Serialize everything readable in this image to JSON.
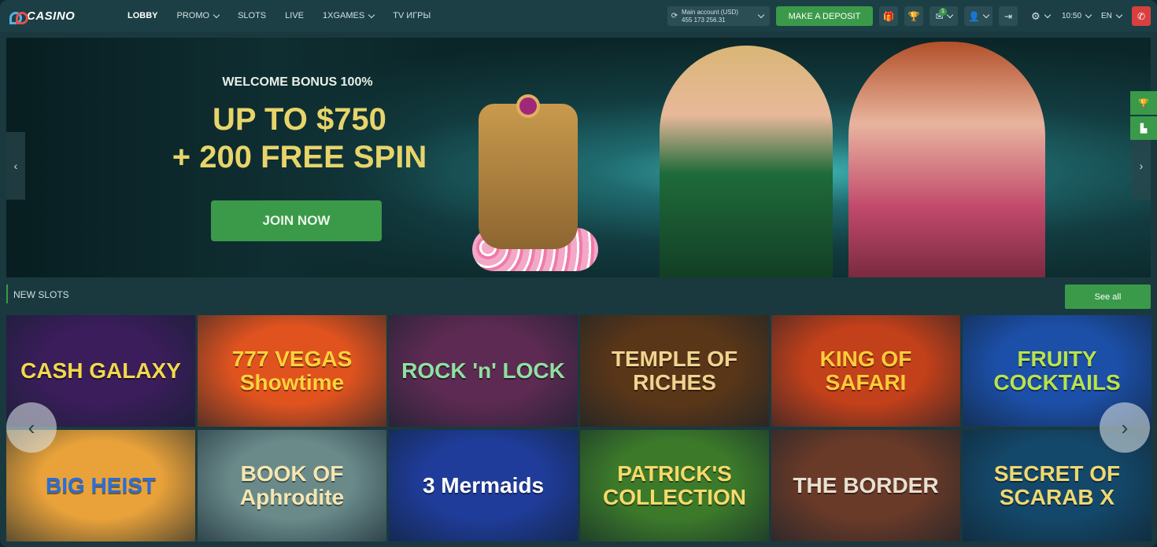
{
  "header": {
    "logo_text": "CASINO",
    "nav": [
      {
        "label": "LOBBY",
        "dropdown": false
      },
      {
        "label": "PROMO",
        "dropdown": true
      },
      {
        "label": "SLOTS",
        "dropdown": false
      },
      {
        "label": "LIVE",
        "dropdown": false
      },
      {
        "label": "1XGAMES",
        "dropdown": true
      },
      {
        "label": "TV ИГРЫ",
        "dropdown": false
      }
    ],
    "account_label": "Main account (USD)",
    "account_id": "455 173 256.31",
    "deposit_label": "MAKE A DEPOSIT",
    "message_count": "1",
    "time": "10:50",
    "language": "EN"
  },
  "banner": {
    "welcome": "WELCOME BONUS 100%",
    "amount_line1": "UP TO $750",
    "amount_line2": "+ 200 FREE SPIN",
    "cta": "JOIN NOW"
  },
  "new_slots": {
    "title": "NEW SLOTS",
    "see_all": "See all",
    "games": [
      {
        "name": "CASH GALAXY",
        "bg": "#3a1d5a",
        "color": "#f2d94a"
      },
      {
        "name": "777 VEGAS Showtime",
        "bg": "#e0531f",
        "color": "#ffd23a"
      },
      {
        "name": "ROCK 'n' LOCK",
        "bg": "#5c2a52",
        "color": "#8fe0a0"
      },
      {
        "name": "TEMPLE OF RICHES",
        "bg": "#5a3618",
        "color": "#f0d490"
      },
      {
        "name": "KING OF SAFARI",
        "bg": "#c2401a",
        "color": "#ffcb3a"
      },
      {
        "name": "FRUITY COCKTAILS",
        "bg": "#1c4fa8",
        "color": "#b9e34a"
      },
      {
        "name": "BIG HEIST",
        "bg": "#e9a23a",
        "color": "#2a6fd8"
      },
      {
        "name": "BOOK OF Aphrodite",
        "bg": "#6a8a8a",
        "color": "#f5e6b0"
      },
      {
        "name": "3 Mermaids",
        "bg": "#1f3c9a",
        "color": "#ffffff"
      },
      {
        "name": "PATRICK'S COLLECTION",
        "bg": "#3c7a2a",
        "color": "#f7d96a"
      },
      {
        "name": "THE BORDER",
        "bg": "#6a3a28",
        "color": "#e8e0d0"
      },
      {
        "name": "SECRET OF SCARAB X",
        "bg": "#14486a",
        "color": "#f0d870"
      }
    ]
  },
  "icons": {
    "refresh": "refresh-icon",
    "gift": "gift-icon",
    "trophy": "trophy-icon",
    "mail": "mail-icon",
    "user": "user-icon",
    "logout": "logout-icon",
    "settings": "gear-icon",
    "phone": "phone-icon"
  },
  "colors": {
    "accent_green": "#3a9a4a",
    "header_bg": "#1c3f45",
    "phone_red": "#d84040",
    "banner_gold": "#e8d46a"
  }
}
